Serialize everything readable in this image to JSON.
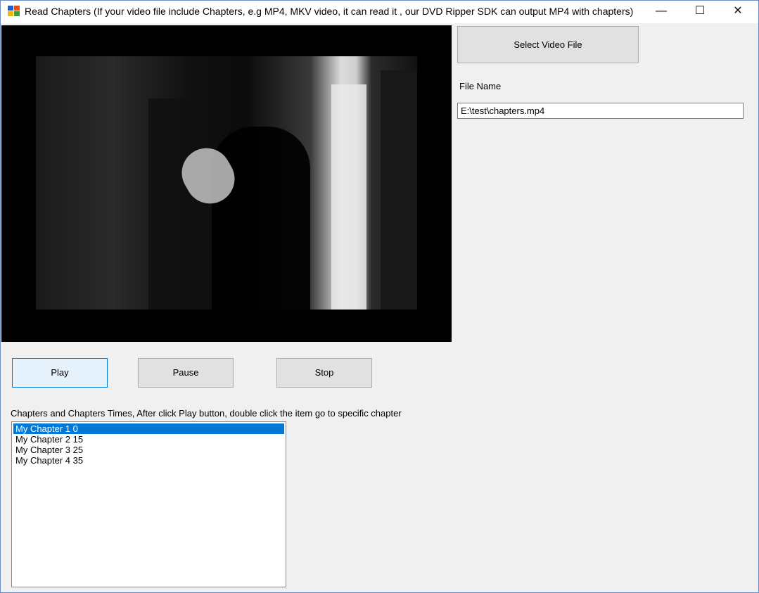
{
  "window": {
    "title": "Read Chapters (If your video file include Chapters, e.g MP4, MKV video, it can read it , our DVD Ripper SDK can output MP4 with chapters)",
    "controls": {
      "minimize": "—",
      "maximize": "☐",
      "close": "✕"
    }
  },
  "toolbar": {
    "select_video_label": "Select Video File"
  },
  "file": {
    "label": "File Name",
    "value": "E:\\test\\chapters.mp4"
  },
  "player": {
    "play_label": "Play",
    "pause_label": "Pause",
    "stop_label": "Stop"
  },
  "chapters": {
    "label": "Chapters and Chapters Times, After click Play button, double click the item go to specific chapter",
    "items": [
      {
        "label": "My Chapter 1 0",
        "selected": true
      },
      {
        "label": "My Chapter 2 15",
        "selected": false
      },
      {
        "label": "My Chapter 3 25",
        "selected": false
      },
      {
        "label": "My Chapter 4 35",
        "selected": false
      }
    ]
  },
  "colors": {
    "selection": "#0078d7",
    "play_focus_border": "#0078d7",
    "window_bg": "#f0f0f0"
  }
}
